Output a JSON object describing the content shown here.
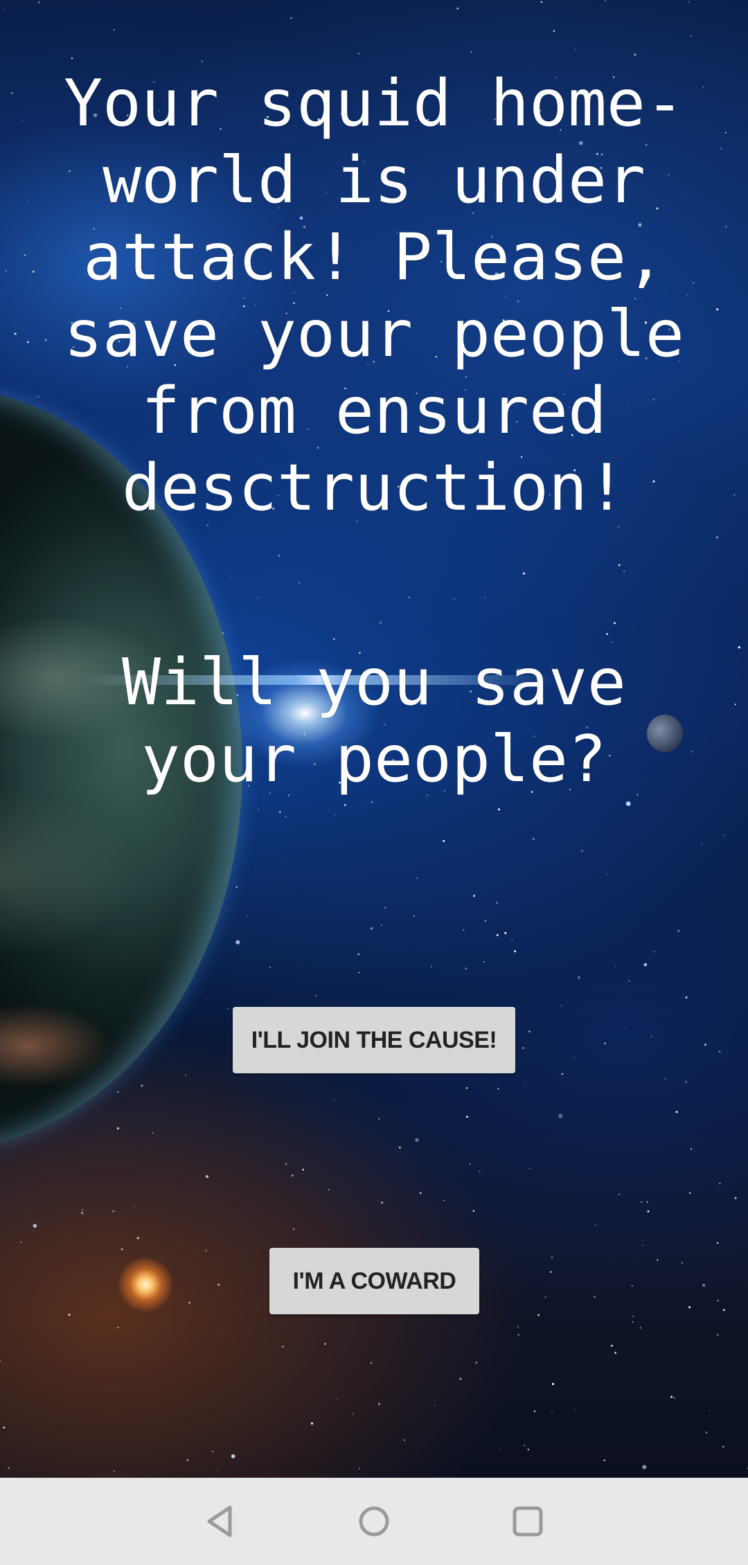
{
  "story": {
    "intro": "Your squid home-world is under attack! Please, save your people from ensured desctruction!",
    "question": "Will you save your people?"
  },
  "actions": {
    "join_label": "I'LL JOIN THE CAUSE!",
    "coward_label": "I'M A COWARD"
  },
  "navigation": {
    "back_icon": "back-triangle-icon",
    "home_icon": "home-circle-icon",
    "recents_icon": "recents-square-icon"
  },
  "colors": {
    "button_background": "#d6d7d7",
    "button_text": "#222222",
    "nav_bar_background": "#e8e8e8",
    "nav_icon": "#9a9a9a",
    "text": "#ffffff"
  }
}
